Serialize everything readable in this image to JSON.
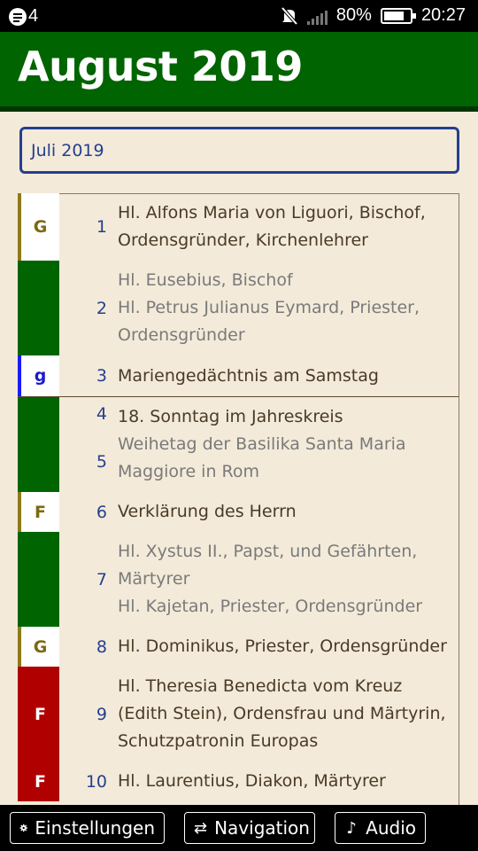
{
  "status_bar": {
    "notification_count": "4",
    "battery_percent": "80%",
    "battery_level": 0.8,
    "time": "20:27"
  },
  "header": {
    "title": "August 2019"
  },
  "month_select": {
    "value": "Juli 2019"
  },
  "days": [
    {
      "day": "1",
      "color_letter": "G",
      "color": "#ffffff",
      "letter_color": "#7a6a10",
      "stripe": "#8f7a1a",
      "week_end": false,
      "entries": [
        {
          "text": "Hl. Alfons Maria von Liguori, Bischof, Ordensgründer, Kirchenlehrer",
          "optional": false
        }
      ]
    },
    {
      "day": "2",
      "color_letter": "",
      "color": "#006400",
      "letter_color": "#ffffff",
      "stripe": "#006400",
      "week_end": false,
      "entries": [
        {
          "text": "Hl. Eusebius, Bischof",
          "optional": true
        },
        {
          "text": "Hl. Petrus Julianus Eymard, Priester, Ordensgründer",
          "optional": true
        }
      ]
    },
    {
      "day": "3",
      "color_letter": "g",
      "color": "#ffffff",
      "letter_color": "#1a1acc",
      "stripe": "#1a1aff",
      "week_end": true,
      "entries": [
        {
          "text": "Mariengedächtnis am Samstag",
          "optional": false
        }
      ]
    },
    {
      "day": "4",
      "color_letter": "",
      "color": "#006400",
      "letter_color": "#ffffff",
      "stripe": "#006400",
      "week_end": false,
      "entries": [
        {
          "text": "18. Sonntag im Jahreskreis",
          "optional": false
        }
      ]
    },
    {
      "day": "5",
      "color_letter": "",
      "color": "#006400",
      "letter_color": "#ffffff",
      "stripe": "#006400",
      "week_end": false,
      "entries": [
        {
          "text": "Weihetag der Basilika Santa Maria Maggiore in Rom",
          "optional": true
        }
      ]
    },
    {
      "day": "6",
      "color_letter": "F",
      "color": "#ffffff",
      "letter_color": "#7a6a10",
      "stripe": "#8f7a1a",
      "week_end": false,
      "entries": [
        {
          "text": "Verklärung des Herrn",
          "optional": false
        }
      ]
    },
    {
      "day": "7",
      "color_letter": "",
      "color": "#006400",
      "letter_color": "#ffffff",
      "stripe": "#006400",
      "week_end": false,
      "entries": [
        {
          "text": "Hl. Xystus II., Papst, und Gefährten, Märtyrer",
          "optional": true
        },
        {
          "text": "Hl. Kajetan, Priester, Ordensgründer",
          "optional": true
        }
      ]
    },
    {
      "day": "8",
      "color_letter": "G",
      "color": "#ffffff",
      "letter_color": "#7a6a10",
      "stripe": "#8f7a1a",
      "week_end": false,
      "entries": [
        {
          "text": "Hl. Dominikus, Priester, Ordensgründer",
          "optional": false
        }
      ]
    },
    {
      "day": "9",
      "color_letter": "F",
      "color": "#b00000",
      "letter_color": "#ffffff",
      "stripe": "#b00000",
      "week_end": false,
      "entries": [
        {
          "text": "Hl. Theresia Benedicta vom Kreuz (Edith Stein), Ordensfrau und Märtyrin, Schutzpatronin Europas",
          "optional": false
        }
      ]
    },
    {
      "day": "10",
      "color_letter": "F",
      "color": "#b00000",
      "letter_color": "#ffffff",
      "stripe": "#b00000",
      "week_end": false,
      "entries": [
        {
          "text": "Hl. Laurentius, Diakon, Märtyrer",
          "optional": false
        }
      ]
    }
  ],
  "bottom_bar": {
    "settings_label": "Einstellungen",
    "navigation_label": "Navigation",
    "audio_label": "Audio"
  }
}
